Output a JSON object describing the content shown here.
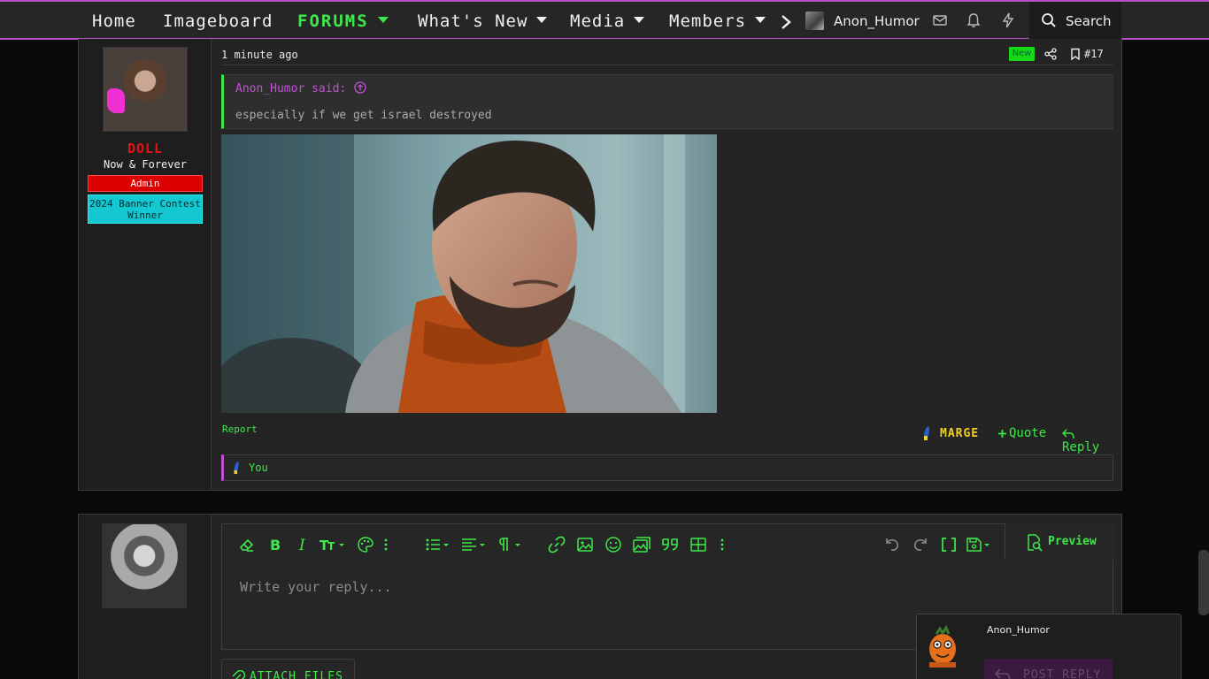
{
  "nav": {
    "home": "Home",
    "imageboard": "Imageboard",
    "forums": "FORUMS",
    "whats_new": "What's New",
    "media": "Media",
    "members": "Members",
    "username": "Anon_Humor",
    "search": "Search"
  },
  "post": {
    "author": "DOLL",
    "user_title": "Now & Forever",
    "badge_admin": "Admin",
    "badge_contest": "2024 Banner Contest Winner",
    "time": "1 minute ago",
    "new_badge": "New",
    "number": "#17",
    "quote_author": "Anon_Humor said:",
    "quote_text": "especially if we get israel destroyed",
    "report": "Report",
    "reactor": "MARGE",
    "quote_action": "Quote",
    "reply_action": "Reply",
    "reaction_summary": "You"
  },
  "editor": {
    "placeholder": "Write your reply...",
    "preview": "Preview",
    "attach": "ATTACH FILES",
    "post_reply": "POST REPLY"
  },
  "chat": {
    "username": "Anon_Humor"
  },
  "colors": {
    "accent_green": "#3ee84a",
    "accent_purple": "#b44fc4",
    "admin_red": "#dd0000",
    "contest_cyan": "#14c8d2",
    "marge_yellow": "#f0d020"
  }
}
